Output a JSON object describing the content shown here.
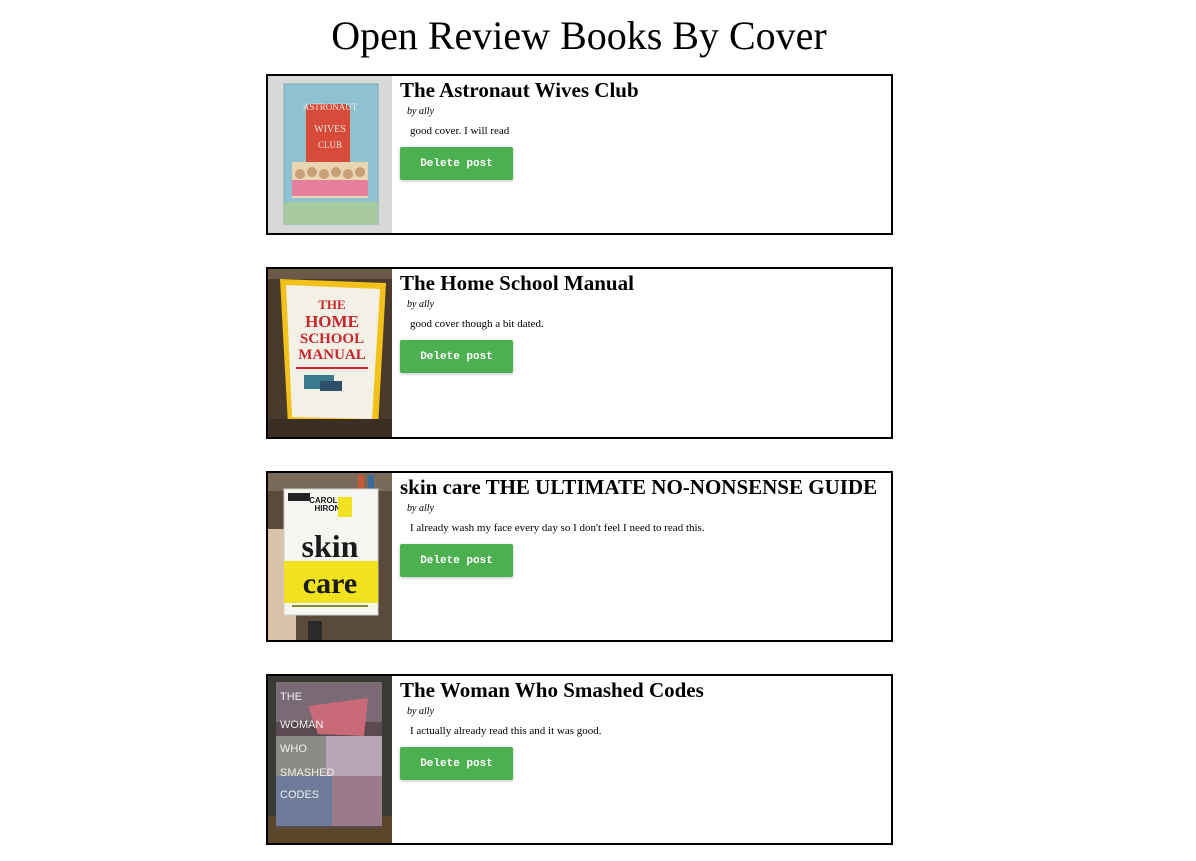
{
  "page": {
    "title": "Open Review Books By Cover"
  },
  "posts": [
    {
      "title": "The Astronaut Wives Club",
      "byline": "by ally",
      "review": "good cover. I will read",
      "delete_label": "Delete post",
      "cover": {
        "background": "#8fc2d0",
        "accent": "#d84a3a",
        "text_lines": [
          "ASTRONAUT",
          "WIVES",
          "CLUB"
        ],
        "text_color": "#f4e7da"
      }
    },
    {
      "title": "The Home School Manual",
      "byline": "by ally",
      "review": "good cover though a bit dated.",
      "delete_label": "Delete post",
      "cover": {
        "background": "#f3f0e6",
        "accent": "#f2c21a",
        "text_lines": [
          "THE",
          "HOME",
          "SCHOOL",
          "MANUAL"
        ],
        "text_color": "#c8262c"
      }
    },
    {
      "title": "skin care THE ULTIMATE NO-NONSENSE GUIDE",
      "byline": "by ally",
      "review": "I already wash my face every day so I don't feel I need to read this.",
      "delete_label": "Delete post",
      "cover": {
        "background": "#f5f5f2",
        "accent": "#f0e21c",
        "text_lines": [
          "CAROLINE",
          "HIRONS",
          "skin",
          "care"
        ],
        "text_color": "#1a1a1a"
      }
    },
    {
      "title": "The Woman Who Smashed Codes",
      "byline": "by ally",
      "review": "I actually already read this and it was good.",
      "delete_label": "Delete post",
      "cover": {
        "background": "#5b4a52",
        "accent": "#b9a6b4",
        "text_lines": [
          "THE",
          "WOMAN",
          "WHO",
          "SMASHED",
          "CODES"
        ],
        "text_color": "#f1eef0"
      }
    }
  ]
}
